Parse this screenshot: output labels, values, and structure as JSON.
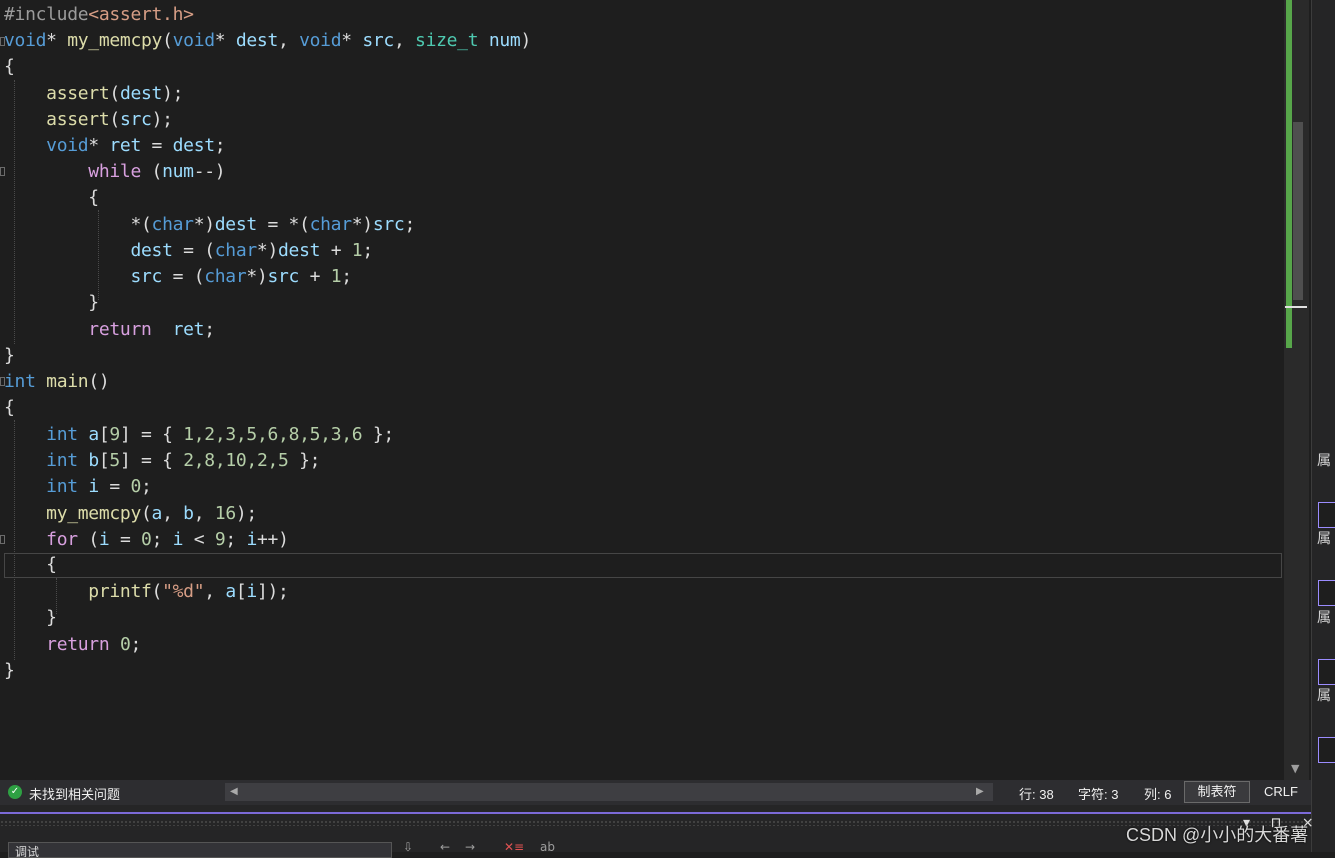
{
  "editor": {
    "include": {
      "directive": "#include",
      "header": "<assert.h>"
    },
    "code": {
      "kw_void": "void",
      "fn_my_memcpy": "my_memcpy",
      "param_dest": "dest",
      "param_src": "src",
      "type_size_t": "size_t",
      "param_num": "num",
      "fn_assert": "assert",
      "var_ret": "ret",
      "kw_while": "while",
      "kw_char": "char",
      "kw_return": "return",
      "kw_int": "int",
      "fn_main": "main",
      "var_a": "a",
      "var_b": "b",
      "var_i": "i",
      "kw_for": "for",
      "fn_printf": "printf",
      "str_format": "\"%d\"",
      "num_9": "9",
      "num_5": "5",
      "num_0": "0",
      "num_1": "1",
      "num_16": "16",
      "array_a_values": "1,2,3,5,6,8,5,3,6",
      "array_b_values": "2,8,10,2,5"
    }
  },
  "status_bar": {
    "issues_text": "未找到相关问题",
    "line": "行: 38",
    "char": "字符: 3",
    "col": "列: 6",
    "indent_mode": "制表符",
    "line_ending": "CRLF"
  },
  "right_panel": {
    "labels": [
      "属",
      "属",
      "属",
      "属"
    ]
  },
  "bottom_panel": {
    "field_text": "调试"
  },
  "watermark": "CSDN @小小的大番薯"
}
